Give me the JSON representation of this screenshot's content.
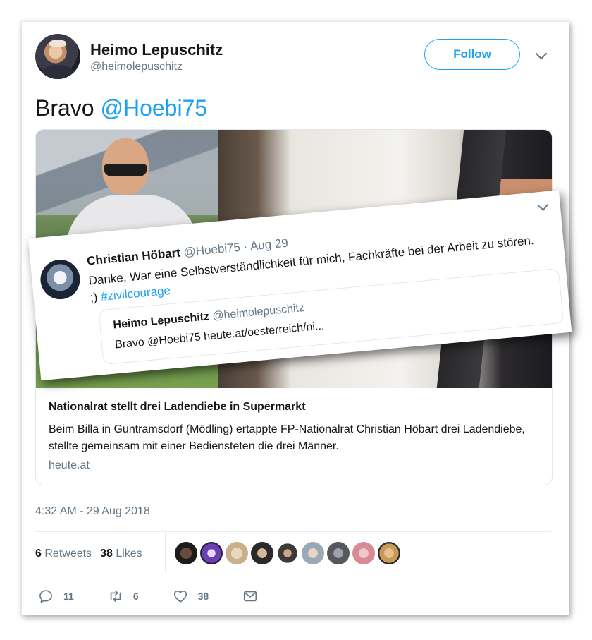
{
  "author": {
    "name": "Heimo Lepuschitz",
    "handle": "@heimolepuschitz"
  },
  "follow_label": "Follow",
  "tweet": {
    "text": "Bravo ",
    "mention": "@Hoebi75"
  },
  "link_card": {
    "title": "Nationalrat stellt drei Ladendiebe in Supermarkt",
    "description": "Beim Billa in Guntramsdorf (Mödling) ertappte FP-Nationalrat Christian Höbart drei Ladendiebe, stellte gemeinsam mit einer Bediensteten die drei Männer.",
    "domain": "heute.at"
  },
  "timestamp": "4:32 AM - 29 Aug 2018",
  "stats": {
    "retweets_count": "6",
    "retweets_label": "Retweets",
    "likes_count": "38",
    "likes_label": "Likes"
  },
  "likers": [
    "#1b1b1b",
    "#6a3fb0",
    "#c8b08a",
    "#2a2a2a",
    "#3a3a3a",
    "#9aa8b8",
    "#55585e",
    "#d88a96",
    "#c89a5a"
  ],
  "actions": {
    "replies": "11",
    "retweets": "6",
    "likes": "38"
  },
  "overlay": {
    "name": "Christian Höbart",
    "meta": "@Hoebi75 · Aug 29",
    "text": "Danke. War eine Selbstverständlichkeit für mich, Fachkräfte bei der Arbeit zu stören. ;) ",
    "hashtag": "#zivilcourage",
    "quote": {
      "name": "Heimo Lepuschitz",
      "handle": "@heimolepuschitz",
      "text": "Bravo @Hoebi75 heute.at/oesterreich/ni..."
    }
  },
  "colors": {
    "accent": "#1da1f2",
    "secondary_text": "#657786",
    "primary_text": "#14171a"
  }
}
